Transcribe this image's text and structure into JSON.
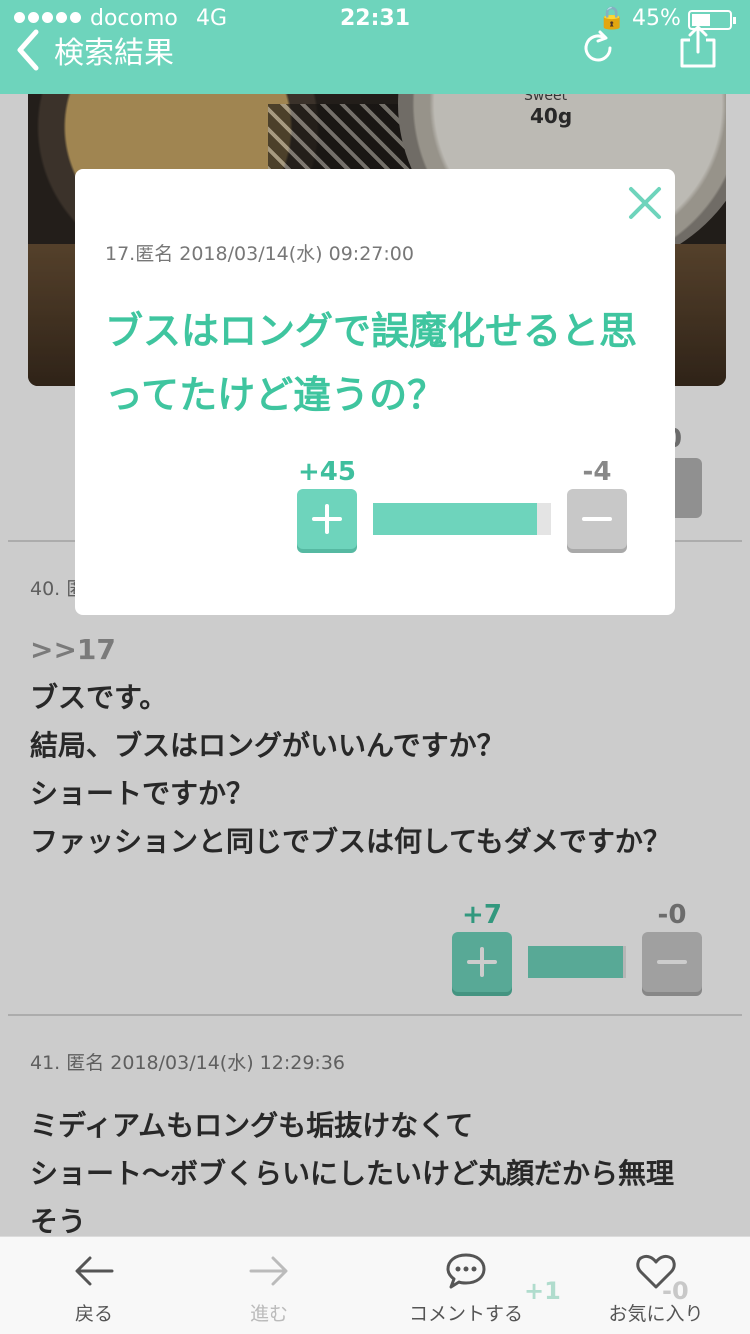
{
  "status_bar": {
    "carrier": "docomo",
    "network": "4G",
    "time": "22:31",
    "battery": "45%"
  },
  "header": {
    "back_label": "検索結果"
  },
  "photo": {
    "brand_text": "Sweet",
    "weight_text": "40g"
  },
  "background_vote": {
    "plus_count_partial": "0"
  },
  "modal": {
    "meta": "17.匿名 2018/03/14(水) 09:27:00",
    "title": "ブスはロングで誤魔化せると思ってたけど違うの？",
    "plus_count": "+45",
    "minus_count": "-4",
    "ratio": 0.92
  },
  "posts": [
    {
      "header_partial": "40. 匿",
      "anchor": ">>17",
      "lines": [
        "ブスです。",
        "結局、ブスはロングがいいんですか？",
        "ショートですか？",
        "ファッションと同じでブスは何してもダメですか？"
      ],
      "plus_count": "+7",
      "minus_count": "-0",
      "ratio": 0.97
    },
    {
      "header": "41. 匿名 2018/03/14(水) 12:29:36",
      "lines": [
        "ミディアムもロングも垢抜けなくて",
        "ショート〜ボブくらいにしたいけど丸顔だから無理",
        "そう"
      ],
      "plus_count": "+1",
      "minus_count": "-0"
    }
  ],
  "tabbar": {
    "items": [
      {
        "label": "戻る",
        "icon": "arrow-left-icon"
      },
      {
        "label": "進む",
        "icon": "arrow-right-icon"
      },
      {
        "label": "コメントする",
        "icon": "comment-icon"
      },
      {
        "label": "お気に入り",
        "icon": "heart-icon"
      }
    ]
  },
  "colors": {
    "accent": "#6ed4bc",
    "title_green": "#3fc59f",
    "minus_gray": "#c8c8c8"
  }
}
